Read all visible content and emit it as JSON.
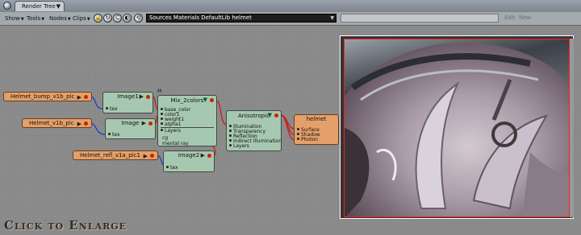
{
  "window": {
    "tab_title": "Render Tree"
  },
  "toolbar": {
    "menus": [
      "Show",
      "Tools",
      "Nodes",
      "Clips"
    ],
    "path": "Sources Materials DefaultLib helmet",
    "edit_label": "Edit",
    "new_label": "New"
  },
  "nodes": {
    "helmet_bump_pic": {
      "label": "Helmet_bump_v1b_pic"
    },
    "helmet_pic": {
      "label": "Helmet_v1b_pic"
    },
    "helmet_refl_pic": {
      "label": "Helmet_refl_v1a_pic1"
    },
    "image1": {
      "label": "Image1",
      "ports": [
        "tex"
      ]
    },
    "image": {
      "label": "Image",
      "ports": [
        "tex"
      ]
    },
    "image2": {
      "label": "Image2",
      "ports": [
        "tex"
      ]
    },
    "mix": {
      "label": "Mix_2colors",
      "marker": "M",
      "ports": [
        "base_color",
        "color1",
        "weight1",
        "alpha1",
        "Layers"
      ],
      "extras": [
        "cg",
        "mental ray"
      ]
    },
    "anisotropic": {
      "label": "Anisotropic",
      "ports": [
        "Illumination",
        "Transparency",
        "Reflection",
        "Indirect Illumination",
        "Layers"
      ]
    },
    "helmet": {
      "label": "helmet",
      "ports": [
        "Surface",
        "Shadow",
        "Photon"
      ]
    }
  },
  "footer": {
    "enlarge_label": "Click to Enlarge"
  },
  "colors": {
    "image_node": "#a7c8b0",
    "material_node": "#e3a06a",
    "wire_red": "#d01818",
    "wire_blue": "#1a3fd0"
  }
}
